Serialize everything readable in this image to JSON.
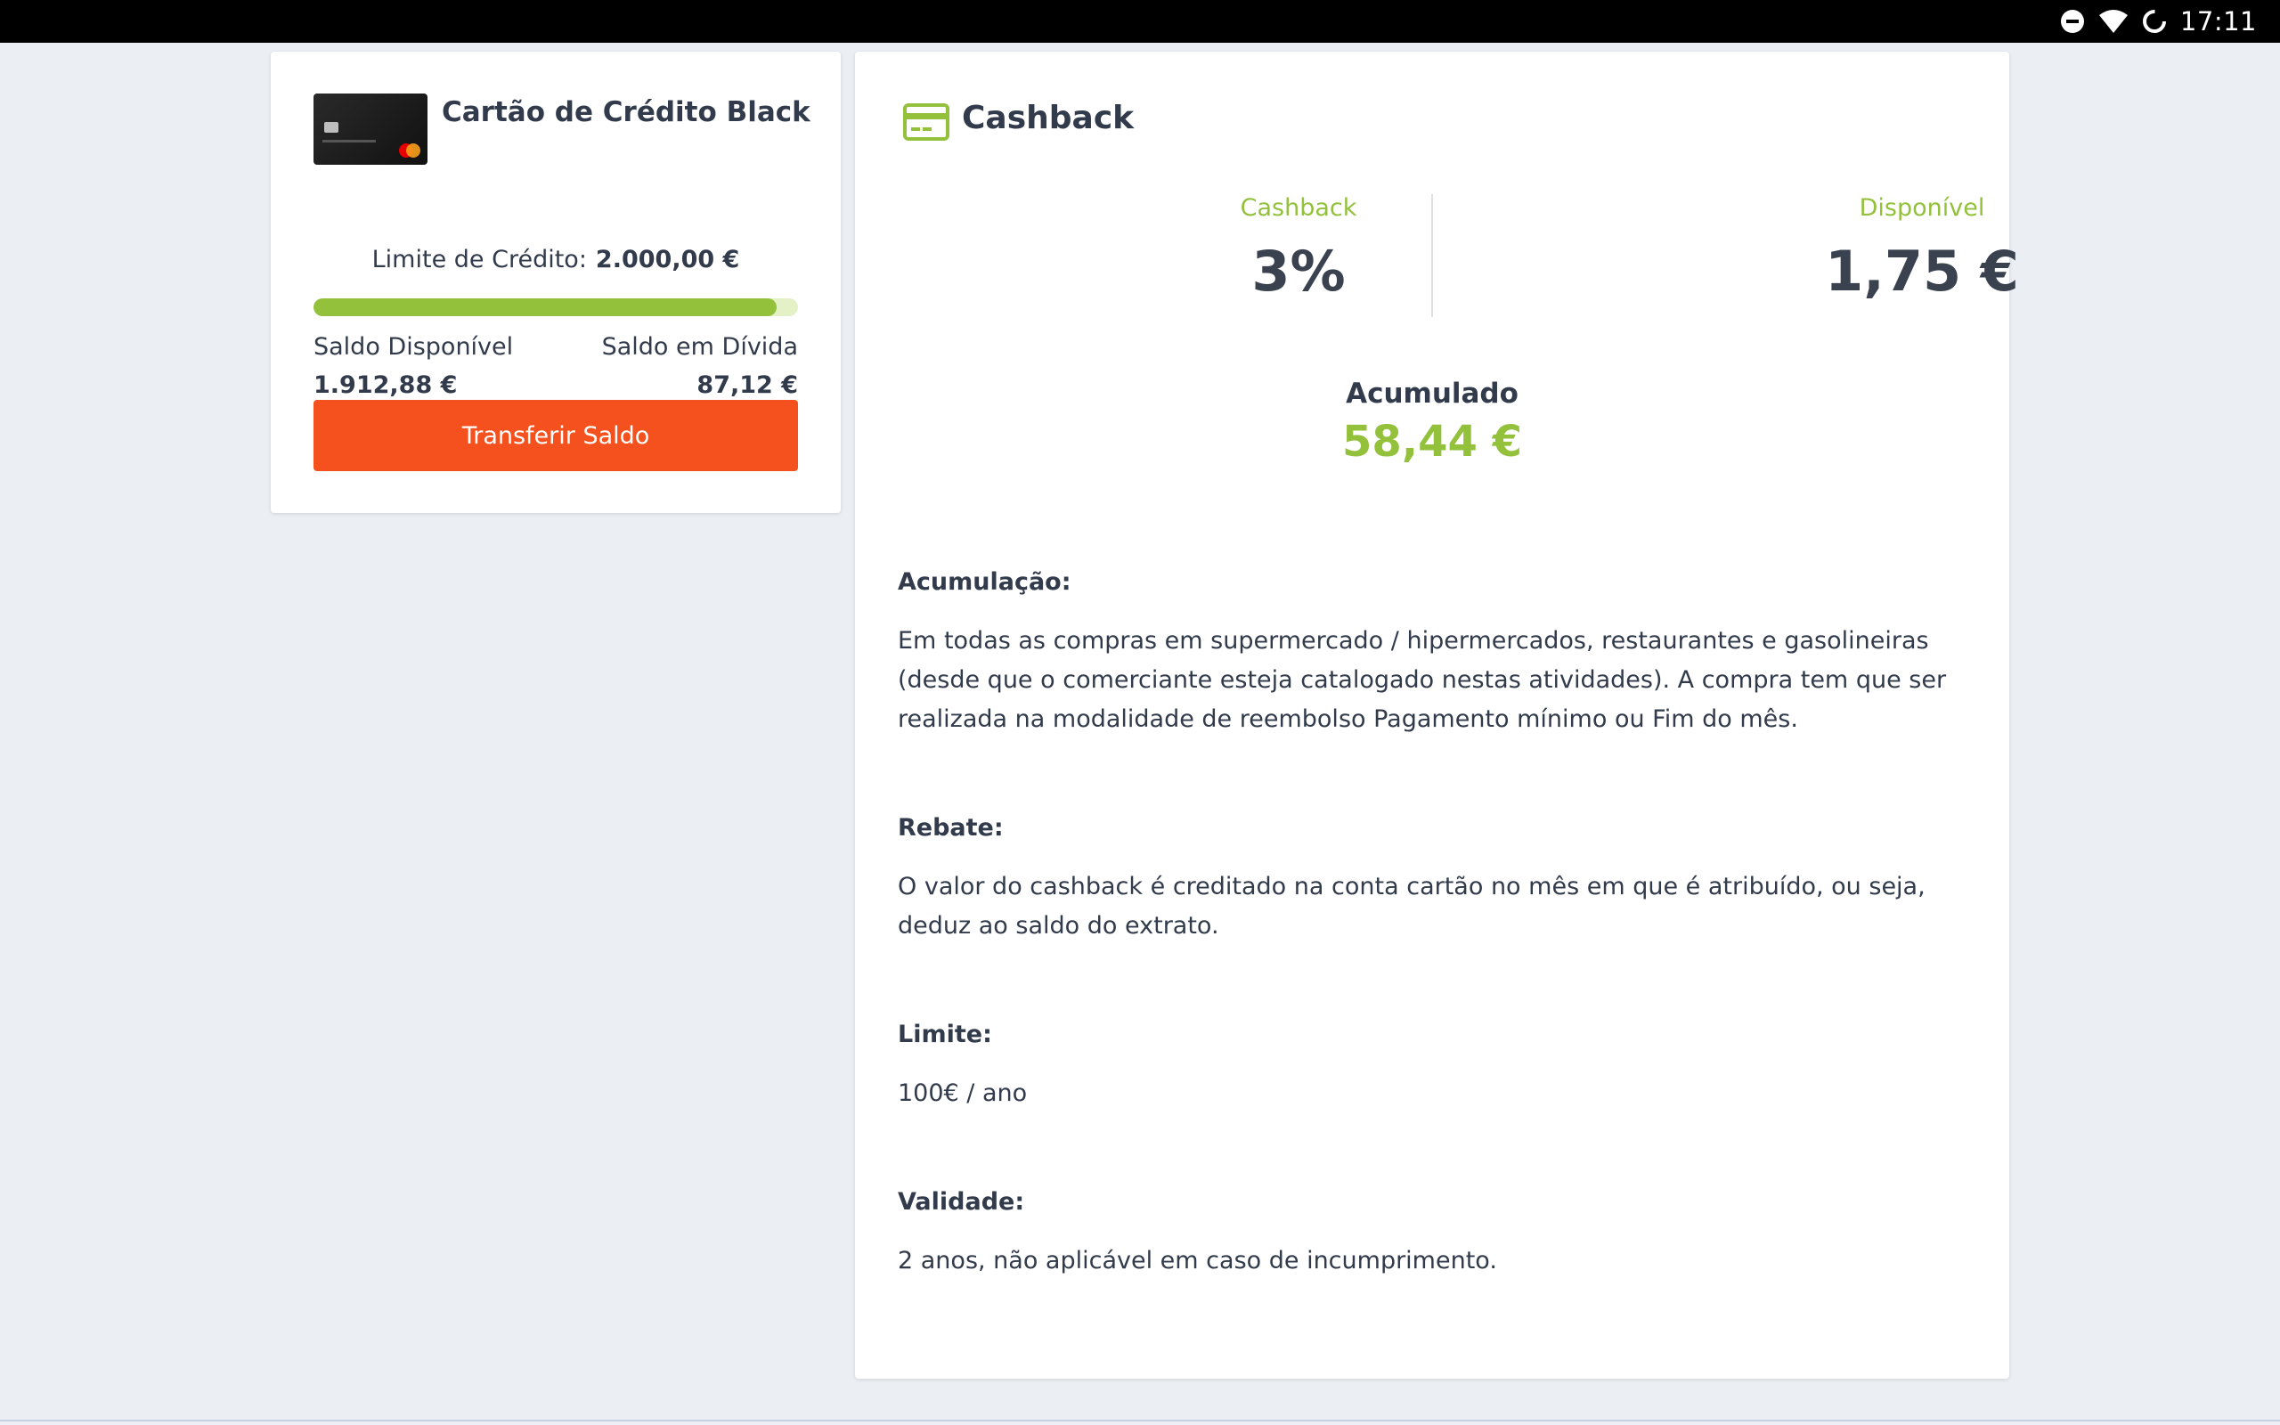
{
  "statusbar": {
    "time": "17:11",
    "icons": [
      "dnd-icon",
      "wifi-icon",
      "loading-icon"
    ]
  },
  "credit_card": {
    "title": "Cartão de Crédito Black",
    "limit_label": "Limite de Crédito:",
    "limit_value": "2.000,00 €",
    "usage_fraction": 0.956,
    "available_label": "Saldo Disponível",
    "available_value": "1.912,88 €",
    "debt_label": "Saldo em Dívida",
    "debt_value": "87,12 €",
    "transfer_button": "Transferir Saldo"
  },
  "cashback": {
    "title": "Cashback",
    "rate_label": "Cashback",
    "rate_value": "3%",
    "available_label": "Disponível",
    "available_value": "1,75 €",
    "accumulated_label": "Acumulado",
    "accumulated_value": "58,44 €",
    "sections": [
      {
        "heading": "Acumulação:",
        "body": "Em todas as compras em supermercado / hipermercados, restaurantes e gasolineiras (desde que o comerciante esteja catalogado nestas atividades). A compra tem que ser realizada na modalidade de reembolso Pagamento mínimo ou Fim do mês."
      },
      {
        "heading": "Rebate:",
        "body": "O valor do cashback é creditado na conta cartão no mês em que é atribuído, ou seja, deduz ao saldo do extrato."
      },
      {
        "heading": "Limite:",
        "body": "100€ / ano"
      },
      {
        "heading": "Validade:",
        "body": "2 anos, não aplicável em caso de incumprimento."
      }
    ]
  },
  "colors": {
    "accent_green": "#93c13c",
    "button_orange": "#f4511e",
    "text_dark": "#323b4b"
  }
}
